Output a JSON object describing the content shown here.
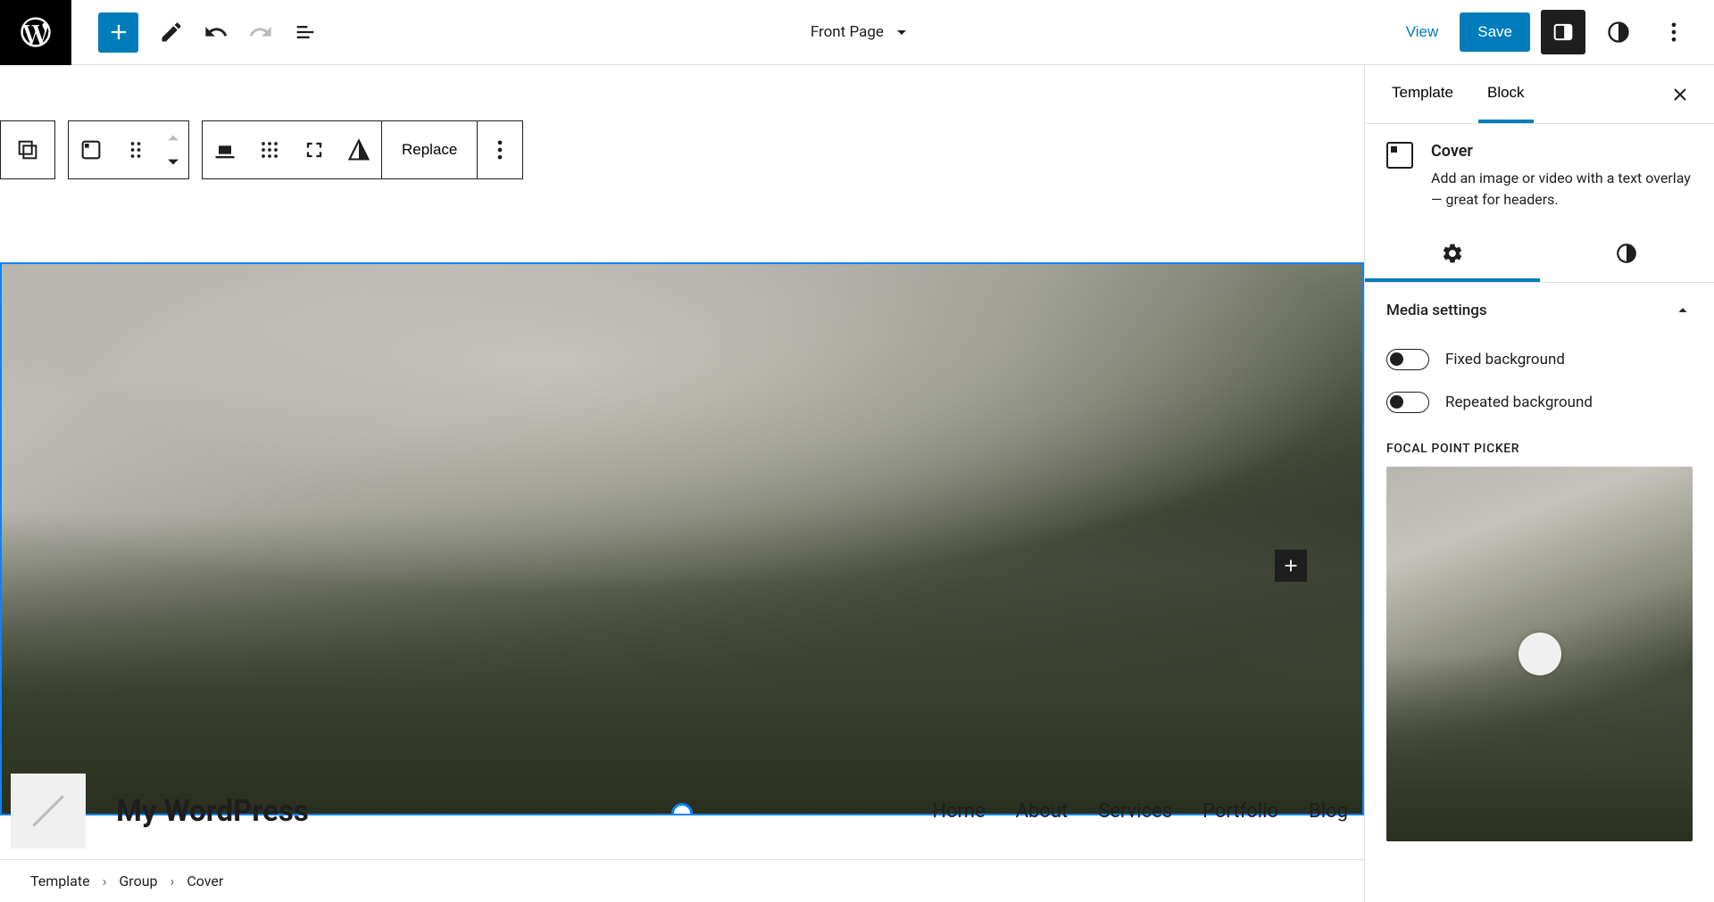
{
  "header": {
    "document_title": "Front Page",
    "view_label": "View",
    "save_label": "Save"
  },
  "block_toolbar": {
    "replace_label": "Replace"
  },
  "site": {
    "title": "My WordPress",
    "nav": [
      "Home",
      "About",
      "Services",
      "Portfolio",
      "Blog"
    ]
  },
  "breadcrumbs": [
    "Template",
    "Group",
    "Cover"
  ],
  "sidebar": {
    "tabs": {
      "template": "Template",
      "block": "Block"
    },
    "block": {
      "title": "Cover",
      "description": "Add an image or video with a text overlay — great for headers."
    },
    "media_settings": {
      "label": "Media settings",
      "fixed_bg": "Fixed background",
      "repeated_bg": "Repeated background",
      "focal_point_label": "Focal Point Picker"
    }
  }
}
